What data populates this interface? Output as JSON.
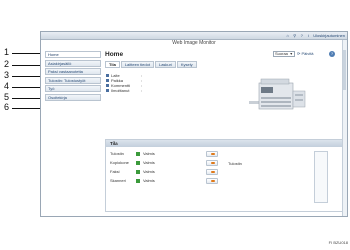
{
  "callouts": [
    "1",
    "2",
    "3",
    "4",
    "5",
    "6"
  ],
  "topbar": {
    "logout_label": "Uloskirjautuminen",
    "home_icon": "home-icon",
    "search_icon": "search-icon",
    "help_icon": "help-icon",
    "info_icon": "info-icon"
  },
  "app_title": "Web Image Monitor",
  "sidebar": {
    "items": [
      {
        "label": "Home"
      },
      {
        "label": "Asiakirjasäilö"
      },
      {
        "label": "Paksi vastaanotetta"
      },
      {
        "label": "Tulostin: Tulostustyöt"
      },
      {
        "label": "Työ"
      },
      {
        "label": "Osoitekirja"
      }
    ]
  },
  "main": {
    "title": "Home",
    "mode_select": "Suoraa",
    "refresh_label": "Päivitä",
    "help_label": "?",
    "tabs": [
      {
        "label": "Tila"
      },
      {
        "label": "Laitteen tiedot"
      },
      {
        "label": "Laskuri"
      },
      {
        "label": "Kysely"
      }
    ],
    "status_items": [
      {
        "label": "Laite",
        "value": ":"
      },
      {
        "label": "Paikka",
        "value": ":"
      },
      {
        "label": "Kommentti",
        "value": ":"
      },
      {
        "label": "Ilmoittanut",
        "value": ":"
      }
    ]
  },
  "tila": {
    "header": "Tila",
    "rows": [
      {
        "name": "Tulostin",
        "value": "Valmis"
      },
      {
        "name": "Kopiokone",
        "value": "Valmis"
      },
      {
        "name": "Faksi",
        "value": "Valmis"
      },
      {
        "name": "Skanneri",
        "value": "Valmis"
      }
    ],
    "toner_label": "Tulostin"
  },
  "figure_id": "FI BZU018",
  "colors": {
    "accent": "#2b4d77",
    "ready": "#3b9a3b",
    "button_arrow": "#e07a1a"
  }
}
